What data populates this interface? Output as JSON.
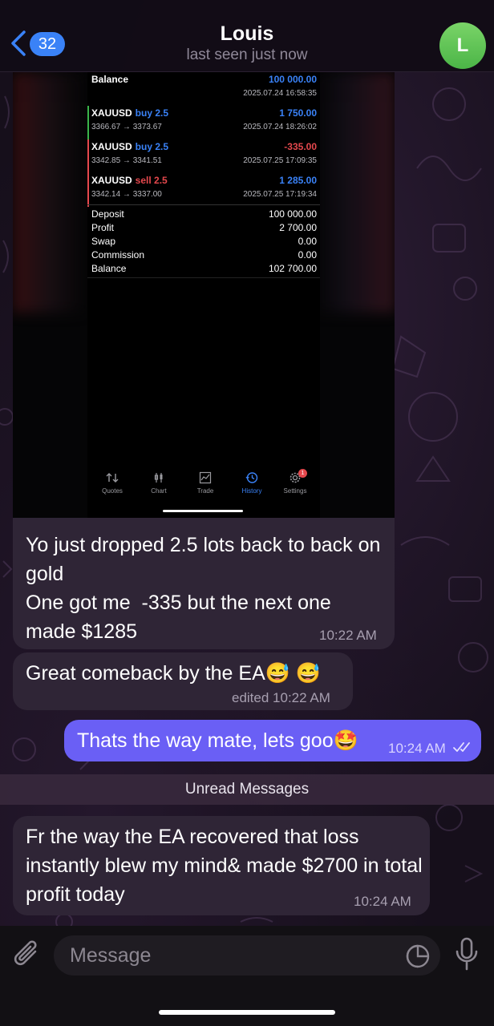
{
  "header": {
    "back_count": "32",
    "title": "Louis",
    "subtitle": "last seen just now",
    "avatar_letter": "L"
  },
  "screenshot": {
    "balance_top": {
      "label": "Balance",
      "value": "100 000.00",
      "date": "2025.07.24 16:58:35"
    },
    "trades": [
      {
        "symbol": "XAUUSD",
        "side": "buy 2.5",
        "side_color": "#3a82f7",
        "prices": "3366.67 → 3373.67",
        "value": "1 750.00",
        "value_color": "#3a82f7",
        "date": "2025.07.24 18:26:02",
        "bar_color": "#3ab54a"
      },
      {
        "symbol": "XAUUSD",
        "side": "buy 2.5",
        "side_color": "#3a82f7",
        "prices": "3342.85 → 3341.51",
        "value": "-335.00",
        "value_color": "#e5484d",
        "date": "2025.07.25 17:09:35",
        "bar_color": "#e5484d"
      },
      {
        "symbol": "XAUUSD",
        "side": "sell 2.5",
        "side_color": "#e5484d",
        "prices": "3342.14 → 3337.00",
        "value": "1 285.00",
        "value_color": "#3a82f7",
        "date": "2025.07.25 17:19:34",
        "bar_color": "#e5484d"
      }
    ],
    "summary": [
      {
        "label": "Deposit",
        "value": "100 000.00"
      },
      {
        "label": "Profit",
        "value": "2 700.00"
      },
      {
        "label": "Swap",
        "value": "0.00"
      },
      {
        "label": "Commission",
        "value": "0.00"
      },
      {
        "label": "Balance",
        "value": "102 700.00"
      }
    ],
    "tabs": [
      {
        "label": "Quotes",
        "icon": "quotes-icon"
      },
      {
        "label": "Chart",
        "icon": "chart-icon"
      },
      {
        "label": "Trade",
        "icon": "trade-icon"
      },
      {
        "label": "History",
        "icon": "history-icon"
      },
      {
        "label": "Settings",
        "icon": "settings-icon"
      }
    ],
    "settings_badge": "1"
  },
  "messages": {
    "m1": {
      "text": "Yo just dropped 2.5 lots back to back on gold\nOne got me  -335 but the next one made $1285",
      "time": "10:22 AM"
    },
    "m2": {
      "text": "Great comeback by the EA😅 😅",
      "time": "edited 10:22 AM"
    },
    "m3": {
      "text": "Thats the way mate, lets goo🤩",
      "time": "10:24 AM"
    },
    "unread_label": "Unread Messages",
    "m4": {
      "text": "Fr the way the EA recovered that loss instantly blew my mind& made $2700 in total profit today",
      "time": "10:24 AM"
    }
  },
  "input": {
    "placeholder": "Message"
  },
  "colors": {
    "accent": "#3a82f7",
    "outgoing_bubble": "#6a5ff5",
    "incoming_bubble": "#2f2536",
    "loss": "#e5484d"
  }
}
